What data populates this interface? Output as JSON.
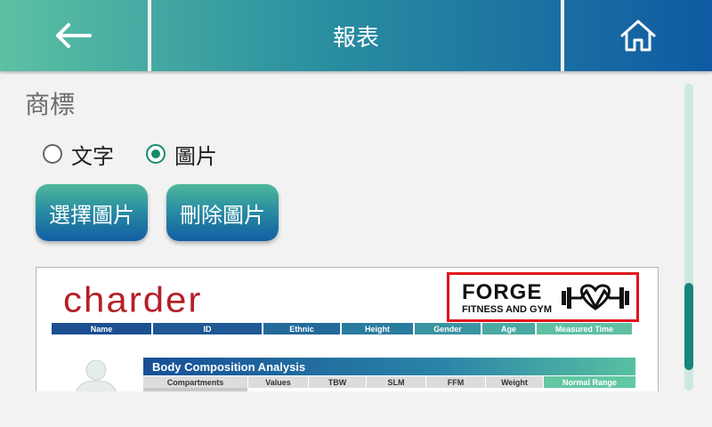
{
  "header": {
    "title": "報表",
    "back_icon": "arrow-left-icon",
    "home_icon": "home-icon"
  },
  "logo_section": {
    "label": "商標",
    "radio_options": [
      {
        "label": "文字",
        "selected": false
      },
      {
        "label": "圖片",
        "selected": true
      }
    ],
    "select_button": "選擇圖片",
    "delete_button": "刪除圖片"
  },
  "preview": {
    "brand": "charder",
    "custom_logo": {
      "title": "FORGE",
      "subtitle": "FITNESS AND GYM"
    },
    "info_columns": [
      "Name",
      "ID",
      "Ethnic",
      "Height",
      "Gender",
      "Age",
      "Measured Time"
    ],
    "analysis_title": "Body Composition Analysis",
    "analysis_columns": [
      "Compartments",
      "Values",
      "TBW",
      "SLM",
      "FFM",
      "Weight",
      "Normal Range"
    ]
  },
  "colors": {
    "accent": "#168a6f",
    "brand_red": "#b51f28",
    "highlight_border": "#e0151b",
    "header_gradient": [
      "#5cc1a3",
      "#0f5aa3"
    ]
  }
}
